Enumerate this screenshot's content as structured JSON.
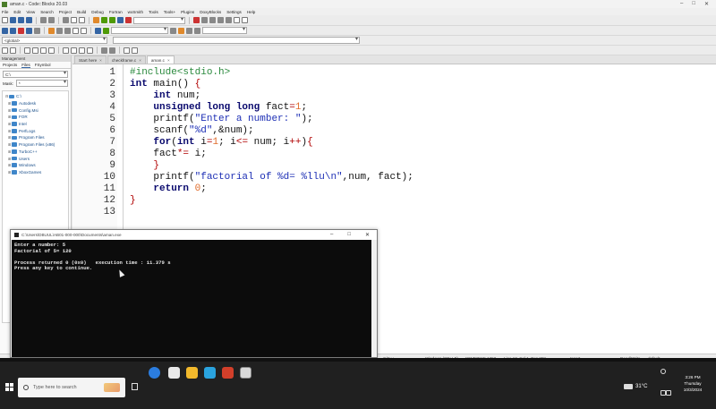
{
  "window": {
    "title": "aman.c - Code::Blocks 20.03"
  },
  "menu": [
    "File",
    "Edit",
    "View",
    "Search",
    "Project",
    "Build",
    "Debug",
    "Fortran",
    "wxSmith",
    "Tools",
    "Tools+",
    "Plugins",
    "DoxyBlocks",
    "Settings",
    "Help"
  ],
  "toolbar": {
    "scope_combo": "<global>"
  },
  "management": {
    "header": "Management",
    "tabs": [
      "Projects",
      "Files",
      "FSymbol"
    ],
    "path": "C:\\",
    "mask_label": "Mask:",
    "mask_value": "*",
    "tree": [
      {
        "label": "C:\\",
        "child": false
      },
      {
        "label": "Autodesk",
        "child": true
      },
      {
        "label": "Config.Msi",
        "child": true
      },
      {
        "label": "FOR",
        "child": true
      },
      {
        "label": "Intel",
        "child": true
      },
      {
        "label": "PerfLogs",
        "child": true
      },
      {
        "label": "Program Files",
        "child": true
      },
      {
        "label": "Program Files (x86)",
        "child": true
      },
      {
        "label": "TurboC++",
        "child": true
      },
      {
        "label": "Users",
        "child": true
      },
      {
        "label": "Windows",
        "child": true
      },
      {
        "label": "XboxGames",
        "child": true
      }
    ]
  },
  "editor": {
    "tabs": [
      {
        "label": "Start here",
        "active": false
      },
      {
        "label": "checkframe.c",
        "active": false
      },
      {
        "label": "aman.c",
        "active": true
      }
    ],
    "line_numbers": [
      "1",
      "2",
      "3",
      "4",
      "5",
      "6",
      "7",
      "8",
      "9",
      "10",
      "11",
      "12",
      "13"
    ]
  },
  "console": {
    "title": "C:\\Users\\DBUUL\\AB01-000-000\\Documents\\aman.exe",
    "lines": [
      "Enter a number: 5",
      "Factorial of 5= 120",
      "",
      "Process returned 0 (0x0)   execution time : 11.379 s",
      "Press any key to continue."
    ]
  },
  "statusbar": {
    "language": "C/C++",
    "eol": "Windows (CR+LF)",
    "encoding": "WINDOWS-1252",
    "position": "Line 13, Col 1, Pos 258",
    "mode": "Insert",
    "access": "Read/Write",
    "profile": "default"
  },
  "taskbar": {
    "search_placeholder": "Type here to search",
    "temperature": "31°C",
    "time": "3:26 PM",
    "day": "Thursday",
    "date": "10/3/2024"
  }
}
